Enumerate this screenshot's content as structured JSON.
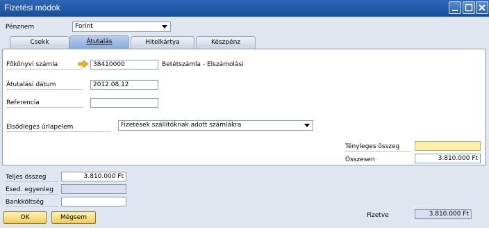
{
  "window": {
    "title": "Fizetési módok"
  },
  "currency": {
    "label": "Pénznem",
    "value": "Forint"
  },
  "tabs": [
    {
      "label": "Csekk"
    },
    {
      "label": "Átutalás"
    },
    {
      "label": "Hitelkártya"
    },
    {
      "label": "Készpénz"
    }
  ],
  "transfer": {
    "gl_account": {
      "label": "Főkönyvi számla",
      "value": "38410000",
      "description": "Betétszámla - Elszámolási"
    },
    "transfer_date": {
      "label": "Átutalási dátum",
      "value": "2012.08.12"
    },
    "reference": {
      "label": "Referencia",
      "value": ""
    },
    "primary_form": {
      "label": "Elsődleges űrlapelem",
      "value": "Fizetések szállítóknak adott számlákra"
    },
    "actual_amount": {
      "label": "Tényleges összeg",
      "value": ""
    },
    "total": {
      "label": "Összesen",
      "value": "3.810.000 Ft"
    }
  },
  "summary": {
    "total_amount": {
      "label": "Teljes összeg",
      "value": "3.810.000 Ft"
    },
    "due_balance": {
      "label": "Esed. egyenleg",
      "value": ""
    },
    "bank_fee": {
      "label": "Bankköltség",
      "value": ""
    },
    "paid": {
      "label": "Fizetve",
      "value": "3.810.000 Ft"
    }
  },
  "buttons": {
    "ok": "OK",
    "cancel": "Mégsem"
  },
  "colors": {
    "titlebar": "#184d9c",
    "active_tab": "#86a9db",
    "button": "#f3cc54",
    "highlight_field": "#fff0a8"
  }
}
